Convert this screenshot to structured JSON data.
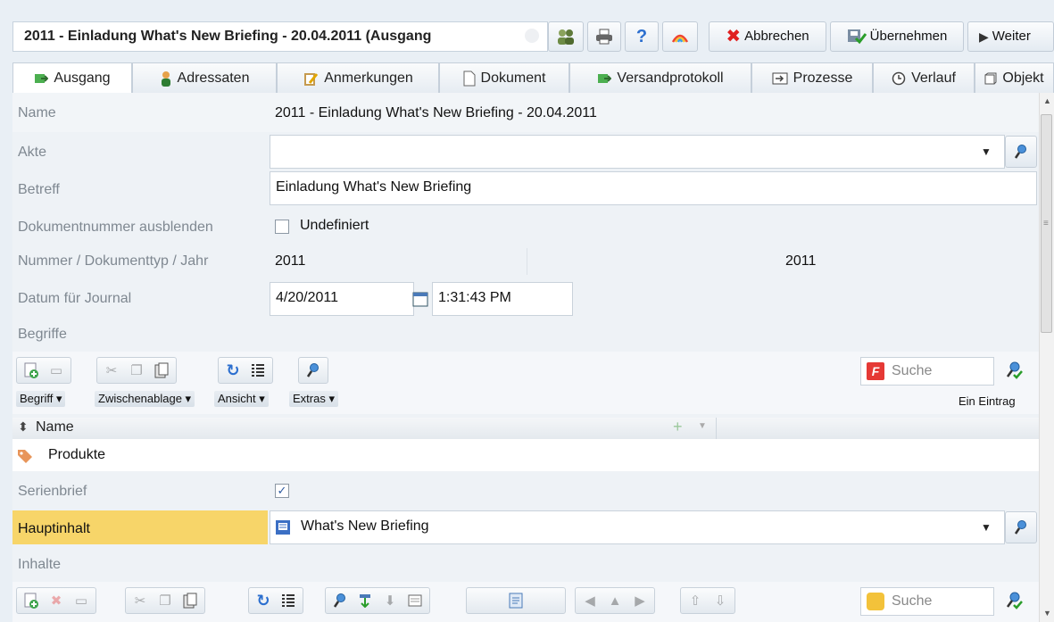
{
  "window": {
    "title": "2011 - Einladung What's New Briefing - 20.04.2011 (Ausgang"
  },
  "toolbar": {
    "cancel_label": "Abbrechen",
    "apply_label": "Übernehmen",
    "next_label": "Weiter",
    "icons": [
      "users-icon",
      "print-icon",
      "help-icon",
      "rainbow-icon"
    ]
  },
  "tabs": [
    {
      "label": "Ausgang",
      "icon": "outgoing-mail-icon",
      "active": true
    },
    {
      "label": "Adressaten",
      "icon": "person-icon"
    },
    {
      "label": "Anmerkungen",
      "icon": "clipboard-pencil-icon"
    },
    {
      "label": "Dokument",
      "icon": "document-icon"
    },
    {
      "label": "Versandprotokoll",
      "icon": "outgoing-mail-icon"
    },
    {
      "label": "Prozesse",
      "icon": "process-icon"
    },
    {
      "label": "Verlauf",
      "icon": "clock-icon"
    },
    {
      "label": "Objekt",
      "icon": "cube-icon"
    }
  ],
  "form": {
    "name": {
      "label": "Name",
      "value": "2011 - Einladung What's New Briefing - 20.04.2011"
    },
    "akte": {
      "label": "Akte",
      "value": ""
    },
    "betreff": {
      "label": "Betreff",
      "value": "Einladung What's New Briefing"
    },
    "docnum": {
      "label": "Dokumentnummer ausblenden",
      "checkbox_label": "Undefiniert",
      "checked": false
    },
    "nummer": {
      "label": "Nummer / Dokumenttyp / Jahr",
      "value1": "2011",
      "value2": "",
      "value3": "2011"
    },
    "datum": {
      "label": "Datum für Journal",
      "date": "4/20/2011",
      "time": "1:31:43 PM"
    },
    "begriffe": {
      "label": "Begriffe",
      "menus": [
        "Begriff ▾",
        "Zwischenablage ▾",
        "Ansicht ▾",
        "Extras ▾"
      ],
      "search_placeholder": "Suche",
      "count": "Ein Eintrag",
      "column": "Name",
      "rows": [
        "Produkte"
      ]
    },
    "serienbrief": {
      "label": "Serienbrief",
      "checked": true
    },
    "hauptinhalt": {
      "label": "Hauptinhalt",
      "value": "What's New Briefing",
      "highlight": "#f7d569"
    },
    "inhalte": {
      "label": "Inhalte",
      "search_placeholder": "Suche"
    }
  },
  "colors": {
    "accent_blue": "#2c6fcf",
    "cancel_red": "#e02020",
    "label_grey": "#7f8891",
    "highlight": "#f7d569"
  }
}
